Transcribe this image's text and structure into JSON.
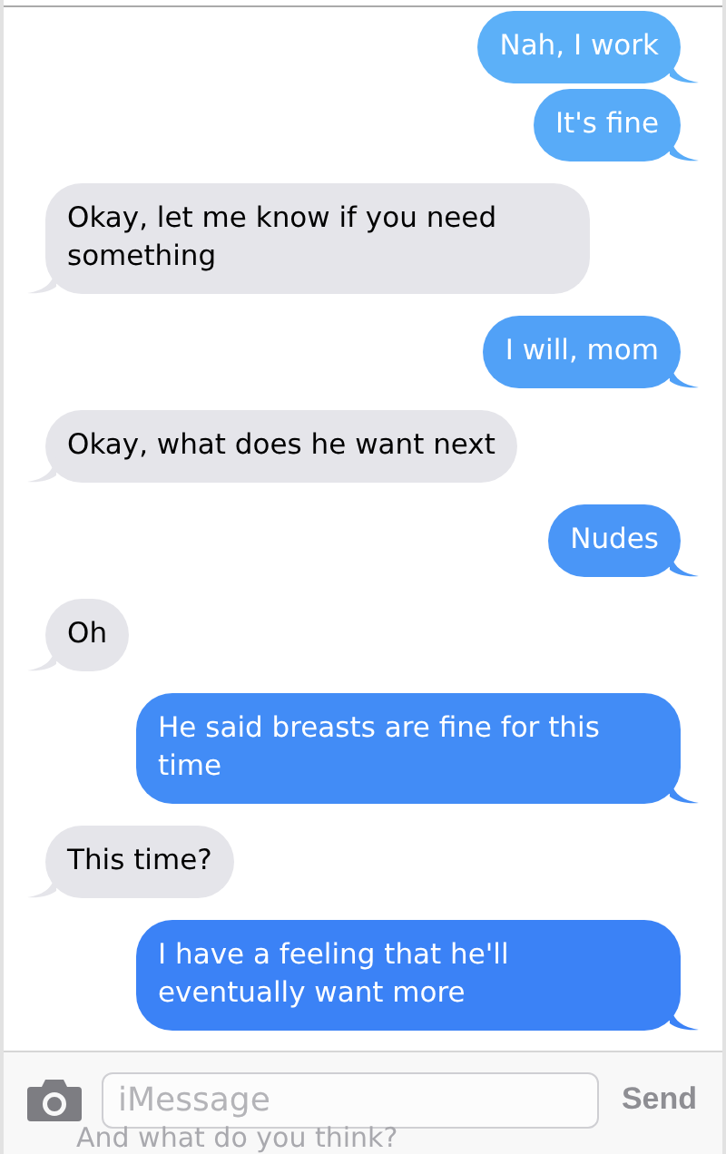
{
  "messages": [
    {
      "kind": "sent",
      "text": "Nah, I work"
    },
    {
      "kind": "sent",
      "text": "It's fine"
    },
    {
      "kind": "received",
      "text": "Okay, let me know if you need something"
    },
    {
      "kind": "sent",
      "text": "I will, mom"
    },
    {
      "kind": "received",
      "text": "Okay, what does he want next"
    },
    {
      "kind": "sent",
      "text": "Nudes"
    },
    {
      "kind": "received",
      "text": "Oh"
    },
    {
      "kind": "sent",
      "text": "He said breasts are fine for this time"
    },
    {
      "kind": "received",
      "text": "This time?"
    },
    {
      "kind": "sent",
      "text": "I have a feeling that he'll eventually want more"
    }
  ],
  "compose_bar": {
    "placeholder": "iMessage",
    "send_label": "Send",
    "underlay_text": "And what do you think?"
  }
}
